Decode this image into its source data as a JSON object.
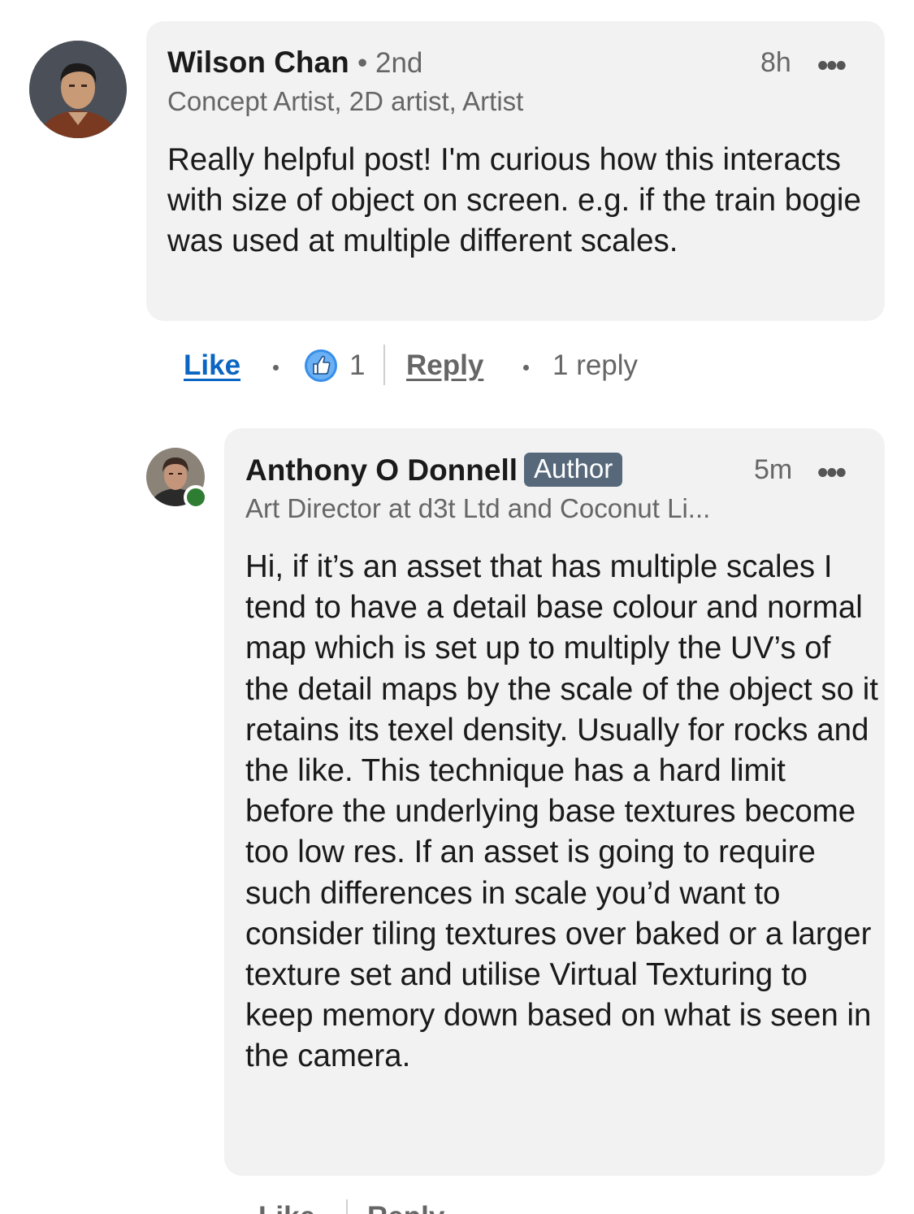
{
  "comments": [
    {
      "author": "Wilson Chan",
      "degree": "• 2nd",
      "headline": "Concept Artist, 2D artist, Artist",
      "time": "8h",
      "more": "•••",
      "body": "Really helpful post! I'm curious how this interacts with size of object on screen. e.g. if the train bogie was used at multiple different scales.",
      "actions": {
        "like_label": "Like",
        "reaction_count": "1",
        "reply_label": "Reply",
        "replies_label": "1 reply"
      }
    }
  ],
  "reply": {
    "author": "Anthony O Donnell",
    "badge": "Author",
    "headline": "Art Director at d3t Ltd and Coconut Li...",
    "time": "5m",
    "more": "•••",
    "body": "Hi, if it’s an asset that has multiple scales I tend to have a detail base colour and normal map which is set up to multiply the UV’s of the detail maps by the scale of the object so it retains its texel density. Usually for rocks and the like. This technique has a hard limit before the underlying base textures become too low res. If an asset is going to require such differences in scale you’d want to consider tiling textures over baked or a larger texture set and utilise Virtual Texturing to keep memory down based on what is seen in the camera.",
    "actions": {
      "like_label": "Like",
      "reply_label": "Reply"
    }
  },
  "colors": {
    "bubble": "#f2f2f2",
    "like": "#0a66c2",
    "badge": "#56687a",
    "online": "#2e7d32"
  },
  "icons": {
    "reaction": "thumbs-up-icon",
    "more": "more-horizontal-icon"
  }
}
